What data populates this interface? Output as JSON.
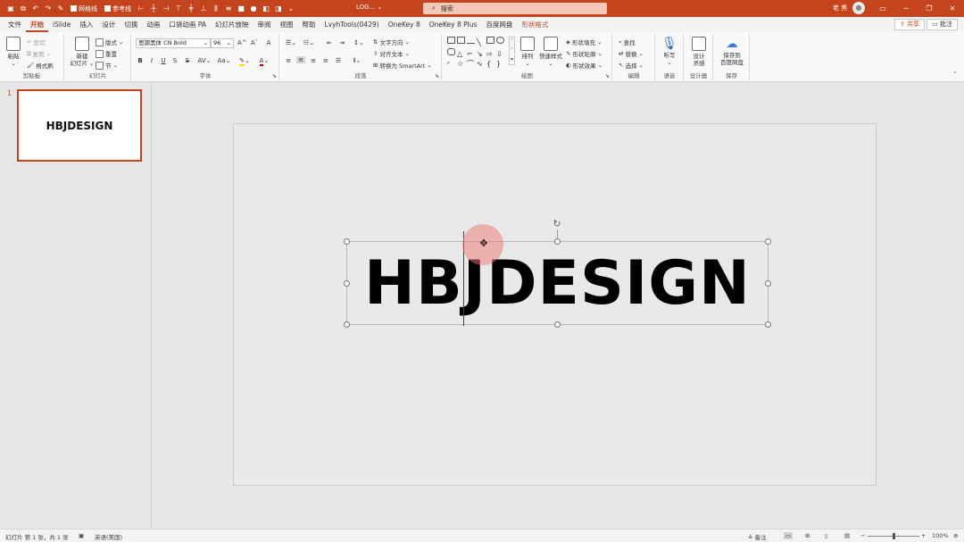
{
  "titlebar": {
    "doc_title": "LOG... ⌄",
    "gridlines_label": "网格线",
    "guides_label": "参考线",
    "search_placeholder": "搜索",
    "user_name": "老 黑",
    "accent": "#c4441e"
  },
  "tabs": [
    "文件",
    "开始",
    "iSlide",
    "插入",
    "设计",
    "切换",
    "动画",
    "口袋动画 PA",
    "幻灯片放映",
    "审阅",
    "视图",
    "帮助",
    "LvyhTools(0429)",
    "OneKey 8",
    "OneKey 8 Plus",
    "百度网盘",
    "形状格式"
  ],
  "active_tab": "开始",
  "share_label": "共享",
  "comment_label": "批注",
  "ribbon": {
    "clipboard": {
      "label": "剪贴板",
      "paste": "粘贴",
      "cut": "剪切",
      "copy": "复制",
      "format_painter": "格式刷"
    },
    "slides": {
      "label": "幻灯片",
      "new_slide_1": "新建",
      "new_slide_2": "幻灯片",
      "layout": "版式",
      "reset": "重置",
      "section": "节"
    },
    "font": {
      "label": "字体",
      "font_name": "思源黑体 CN Bold",
      "font_size": "96",
      "bold": "B",
      "italic": "I",
      "underline": "U",
      "strike": "S",
      "spacing": "AV",
      "case": "Aa",
      "clear": "A",
      "grow": "A",
      "shrink": "A"
    },
    "paragraph": {
      "label": "段落",
      "text_direction": "文字方向",
      "align_text": "对齐文本",
      "smartart": "转换为 SmartArt"
    },
    "drawing": {
      "label": "绘图",
      "arrange": "排列",
      "quick_styles": "快速样式",
      "shape_fill": "形状填充",
      "shape_outline": "形状轮廓",
      "shape_effects": "形状效果"
    },
    "editing": {
      "label": "编辑",
      "find": "查找",
      "replace": "替换",
      "select": "选择"
    },
    "voice": {
      "label": "语音",
      "dictate": "听写"
    },
    "designer": {
      "label": "设计器",
      "ideas_1": "设计",
      "ideas_2": "灵感"
    },
    "save": {
      "label": "保存",
      "save_1": "保存到",
      "save_2": "百度网盘"
    }
  },
  "thumbnail": {
    "number": "1",
    "text": "HBJDESIGN"
  },
  "slide": {
    "text": "HBJDESIGN"
  },
  "statusbar": {
    "slide_info": "幻灯片 第 1 张，共 1 张",
    "language": "英语(美国)",
    "notes": "备注",
    "zoom": "100%",
    "zoom_value": 100
  }
}
